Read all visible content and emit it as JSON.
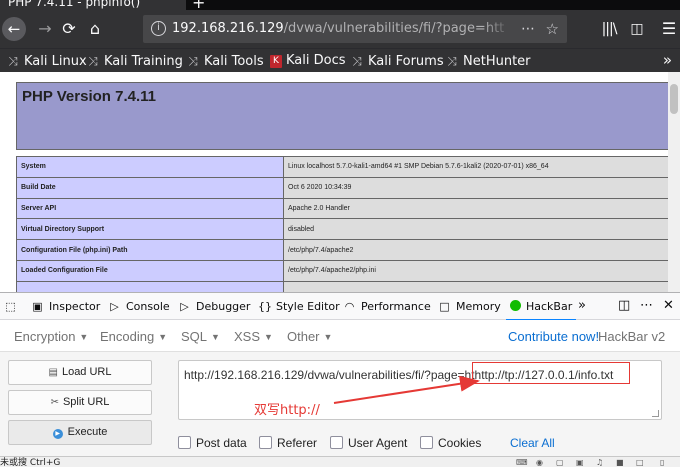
{
  "browser": {
    "tab_title": "PHP 7.4.11 - phpinfo()",
    "new_tab_glyph": "+",
    "url_host": "192.168.216.129",
    "url_path": "/dvwa/vulnerabilities/fi/?page=htt",
    "icons": [
      "back-icon",
      "forward-icon",
      "reload-icon",
      "home-icon",
      "info-icon",
      "reader-icon",
      "star-icon",
      "library-icon",
      "sidebar-icon",
      "menu-icon"
    ],
    "bookmarks": [
      {
        "label": "Kali Linux",
        "icon": "kali-dragon-icon"
      },
      {
        "label": "Kali Training",
        "icon": "kali-dragon-icon"
      },
      {
        "label": "Kali Tools",
        "icon": "kali-dragon-icon"
      },
      {
        "label": "Kali Docs",
        "icon": "kali-docs-icon"
      },
      {
        "label": "Kali Forums",
        "icon": "kali-dragon-icon"
      },
      {
        "label": "NetHunter",
        "icon": "kali-dragon-icon"
      }
    ]
  },
  "phpinfo": {
    "title": "PHP Version 7.4.11",
    "rows": [
      {
        "key": "System",
        "value": "Linux localhost 5.7.0-kali1-amd64 #1 SMP Debian 5.7.6-1kali2 (2020-07-01) x86_64"
      },
      {
        "key": "Build Date",
        "value": "Oct 6 2020 10:34:39"
      },
      {
        "key": "Server API",
        "value": "Apache 2.0 Handler"
      },
      {
        "key": "Virtual Directory Support",
        "value": "disabled"
      },
      {
        "key": "Configuration File (php.ini) Path",
        "value": "/etc/php/7.4/apache2"
      },
      {
        "key": "Loaded Configuration File",
        "value": "/etc/php/7.4/apache2/php.ini"
      },
      {
        "key": "",
        "value": ""
      }
    ]
  },
  "devtools": {
    "tabs": [
      {
        "label": "Inspector"
      },
      {
        "label": "Console"
      },
      {
        "label": "Debugger"
      },
      {
        "label": "Style Editor"
      },
      {
        "label": "Performance"
      },
      {
        "label": "Memory"
      },
      {
        "label": "HackBar"
      }
    ],
    "more_glyph": "»"
  },
  "hackbar": {
    "menus": [
      "Encryption",
      "Encoding",
      "SQL",
      "XSS",
      "Other"
    ],
    "contribute": "Contribute now!",
    "version": "HackBar v2",
    "buttons": {
      "load": "Load URL",
      "split": "Split URL",
      "execute": "Execute"
    },
    "url_value": "http://192.168.216.129/dvwa/vulnerabilities/fi/?page=hthttp://tp://127.0.0.1/info.txt",
    "annotation": "双写http://",
    "checks": [
      "Post data",
      "Referer",
      "User Agent",
      "Cookies"
    ],
    "clear_all": "Clear All"
  },
  "status": {
    "text": "未或搜 Ctrl+G"
  },
  "colors": {
    "accent": "#0a84ff",
    "php_header": "#9999cc",
    "php_key": "#ccccff",
    "php_value": "#dddddd",
    "annotation": "#e53935"
  }
}
